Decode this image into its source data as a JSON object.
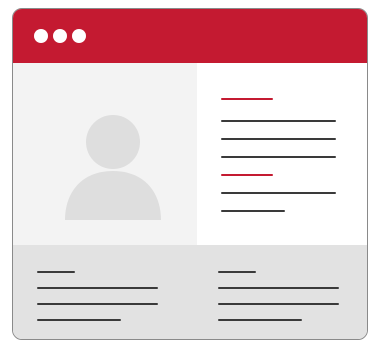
{
  "colors": {
    "accent": "#c41a31",
    "panel_light": "#f3f3f3",
    "footer": "#e2e2e2",
    "text_line": "#3a3a3a",
    "avatar": "#dedede"
  },
  "titlebar": {
    "window_controls": [
      "dot",
      "dot",
      "dot"
    ]
  },
  "profile": {
    "avatar_icon": "user-silhouette-icon"
  },
  "details": {
    "sections": [
      {
        "heading": "placeholder-line",
        "lines": 3
      },
      {
        "heading": "placeholder-line",
        "lines": 2
      }
    ]
  },
  "footer": {
    "columns": [
      {
        "heading": "placeholder-line",
        "lines": 3
      },
      {
        "heading": "placeholder-line",
        "lines": 3
      }
    ]
  }
}
